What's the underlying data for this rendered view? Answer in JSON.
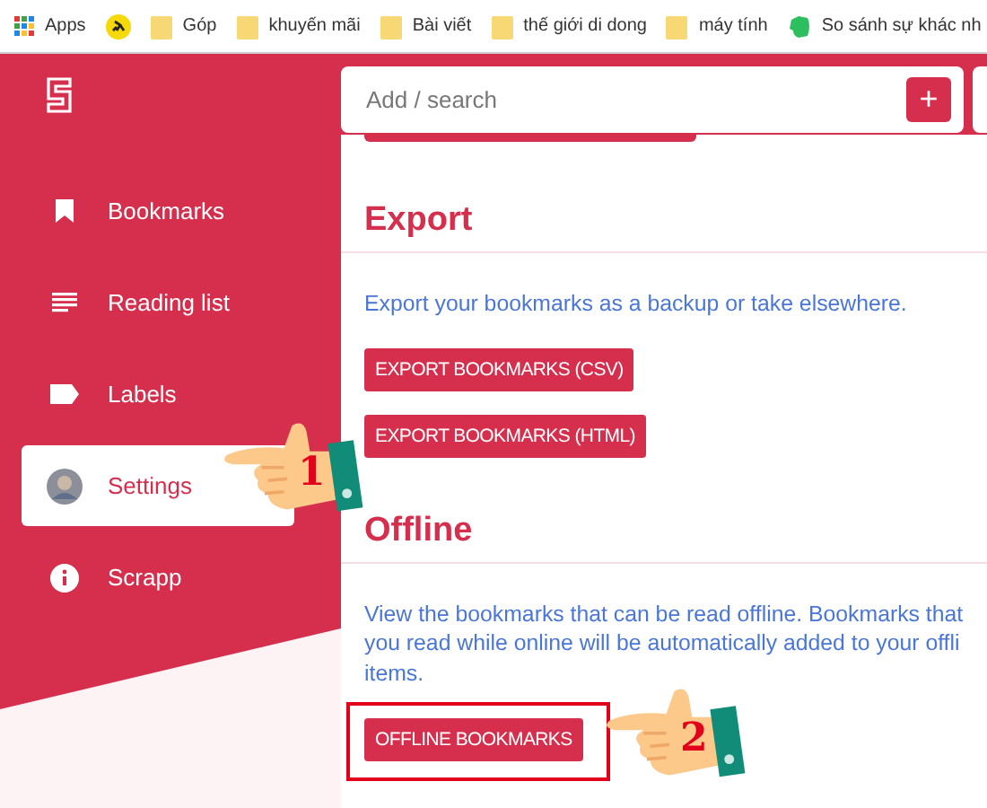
{
  "bookmarks_bar": [
    {
      "kind": "apps",
      "label": "Apps"
    },
    {
      "kind": "site"
    },
    {
      "kind": "folder",
      "label": "Góp"
    },
    {
      "kind": "folder",
      "label": "khuyến mãi"
    },
    {
      "kind": "folder",
      "label": "Bài viết"
    },
    {
      "kind": "folder",
      "label": "thế giới di dong"
    },
    {
      "kind": "folder",
      "label": "máy tính"
    },
    {
      "kind": "note",
      "label": "So sánh sự khác nh"
    }
  ],
  "sidebar": {
    "items": [
      {
        "label": "Bookmarks",
        "selected": false
      },
      {
        "label": "Reading list",
        "selected": false
      },
      {
        "label": "Labels",
        "selected": false
      },
      {
        "label": "Settings",
        "selected": true
      },
      {
        "label": "Scrapp",
        "selected": false
      }
    ]
  },
  "search": {
    "placeholder": "Add / search",
    "add_button": "+"
  },
  "sections": [
    {
      "heading": "Export",
      "text_lines": [
        "Export your bookmarks as a backup or take elsewhere."
      ],
      "buttons": [
        {
          "label": "EXPORT BOOKMARKS (CSV)",
          "highlighted": false
        },
        {
          "label": "EXPORT BOOKMARKS (HTML)",
          "highlighted": false
        }
      ]
    },
    {
      "heading": "Offline",
      "text_lines": [
        "View the bookmarks that can be read offline. Bookmarks that",
        "you read while online will be automatically added to your offli",
        "items."
      ],
      "buttons": [
        {
          "label": "OFFLINE BOOKMARKS",
          "highlighted": true
        }
      ]
    }
  ],
  "annotations": [
    {
      "number": "1"
    },
    {
      "number": "2"
    }
  ]
}
